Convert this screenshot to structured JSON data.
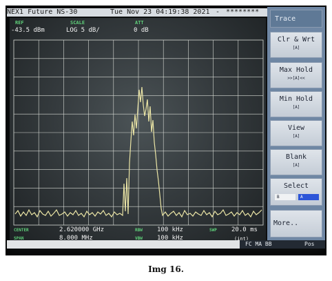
{
  "titlebar": {
    "model": "NEX1 Future NS-30",
    "datetime": "Tue Nov 23 04:19:38 2021",
    "dash": "-",
    "masked": "********"
  },
  "header": {
    "ref_label": "REF",
    "ref_value": "-43.5 dBm",
    "scale_label": "SCALE",
    "scale_value": "LOG  5 dB/",
    "att_label": "ATT",
    "att_value": "0 dB"
  },
  "footer": {
    "center_label": "CENTER",
    "center_value": "2.620000 GHz",
    "span_label": "SPAN",
    "span_value": "8.000 MHz",
    "rbw_label": "RBW",
    "rbw_value": "100 kHz",
    "vbw_label": "VBW",
    "vbw_value": "100 kHz",
    "swp_label": "SWP",
    "swp_value": "20.0 ms",
    "int_value": "(int)"
  },
  "softkeys": {
    "trace": "Trace",
    "clr_wrt": "Clr & Wrt",
    "clr_wrt_sub": "[A]",
    "max_hold": "Max  Hold",
    "max_hold_sub": ">>[A]<<",
    "min_hold": "Min  Hold",
    "min_hold_sub": "[A]",
    "view": "View",
    "view_sub": "[A]",
    "blank": "Blank",
    "blank_sub": "[A]",
    "select": "Select",
    "select_b": "B",
    "select_a": "A",
    "more": "More.."
  },
  "status": {
    "flags": "FC MA BB",
    "mode": "Pos"
  },
  "caption": "Img 16.",
  "colors": {
    "trace": "#ece6a6",
    "grid": "#d9dcd6",
    "panel": "#6f87a4",
    "select_active": "#2c55d8"
  }
}
